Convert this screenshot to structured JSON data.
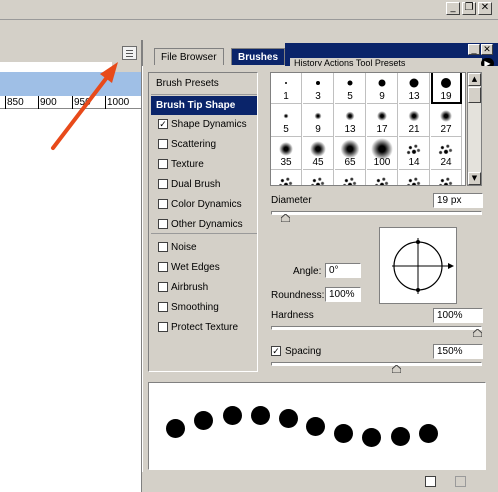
{
  "window_controls": {
    "minimize": "_",
    "restore": "❐",
    "close": "✕"
  },
  "ruler": {
    "labels": [
      "850",
      "900",
      "950",
      "1000"
    ]
  },
  "tabs": {
    "file_browser": "File Browser",
    "brushes": "Brushes"
  },
  "panel2": {
    "tabs_text": "History  Actions  Tool Presets"
  },
  "left_list": {
    "brush_presets": "Brush Presets",
    "brush_tip_shape": "Brush Tip Shape",
    "options": [
      {
        "label": "Shape Dynamics",
        "checked": true
      },
      {
        "label": "Scattering",
        "checked": false
      },
      {
        "label": "Texture",
        "checked": false
      },
      {
        "label": "Dual Brush",
        "checked": false
      },
      {
        "label": "Color Dynamics",
        "checked": false
      },
      {
        "label": "Other Dynamics",
        "checked": false
      },
      {
        "label": "Noise",
        "checked": false
      },
      {
        "label": "Wet Edges",
        "checked": false
      },
      {
        "label": "Airbrush",
        "checked": false
      },
      {
        "label": "Smoothing",
        "checked": false
      },
      {
        "label": "Protect Texture",
        "checked": false
      }
    ]
  },
  "brush_grid": {
    "rows": [
      [
        "1",
        "3",
        "5",
        "9",
        "13",
        "19"
      ],
      [
        "5",
        "9",
        "13",
        "17",
        "21",
        "27"
      ],
      [
        "35",
        "45",
        "65",
        "100",
        "14",
        "24"
      ],
      [
        "",
        "",
        "",
        "",
        "",
        ""
      ]
    ],
    "selected": "19"
  },
  "controls": {
    "diameter_label": "Diameter",
    "diameter_value": "19 px",
    "angle_label": "Angle:",
    "angle_value": "0°",
    "roundness_label": "Roundness:",
    "roundness_value": "100%",
    "hardness_label": "Hardness",
    "hardness_value": "100%",
    "spacing_label": "Spacing",
    "spacing_value": "150%",
    "spacing_checked": "✓",
    "diameter_fraction": 0.05,
    "hardness_fraction": 1.0,
    "spacing_fraction": 0.6
  },
  "colors": {
    "selection_blue": "#0a246a",
    "annotation_arrow": "#e84a1a",
    "ruler_blue": "#9fbfe6"
  },
  "icons": [
    "palette-dock-icon",
    "angle-crosshair-icon",
    "new-preset-icon",
    "trash-icon",
    "panel-menu-icon"
  ]
}
